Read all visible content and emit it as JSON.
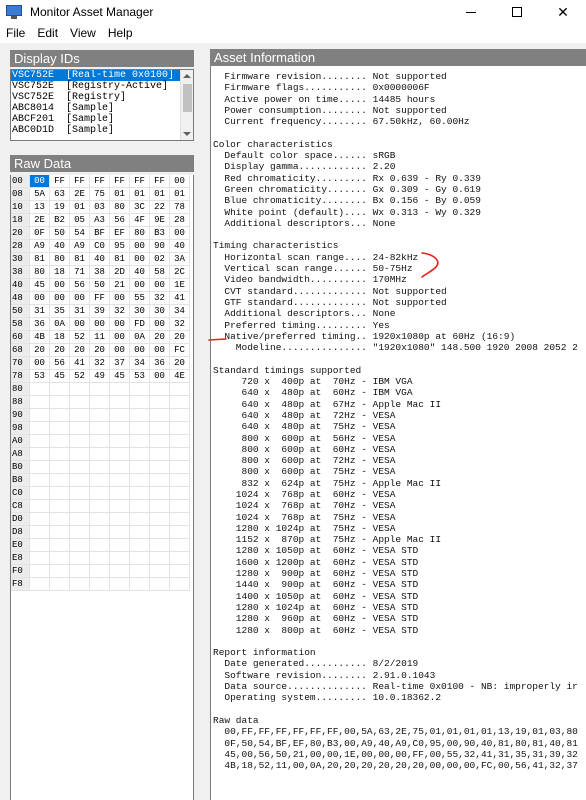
{
  "window": {
    "title": "Monitor Asset Manager"
  },
  "menu": [
    "File",
    "Edit",
    "View",
    "Help"
  ],
  "display_ids": {
    "header": "Display IDs",
    "items": [
      "VSC752E  [Real-time 0x0100]",
      "VSC752E  [Registry-Active]",
      "VSC752E  [Registry]",
      "ABC8014  [Sample]",
      "ABCF201  [Sample]",
      "ABC0D1D  [Sample]"
    ]
  },
  "raw_data": {
    "header": "Raw Data",
    "rows": [
      [
        "00",
        "00",
        "FF",
        "FF",
        "FF",
        "FF",
        "FF",
        "FF",
        "00"
      ],
      [
        "08",
        "5A",
        "63",
        "2E",
        "75",
        "01",
        "01",
        "01",
        "01"
      ],
      [
        "10",
        "13",
        "19",
        "01",
        "03",
        "80",
        "3C",
        "22",
        "78"
      ],
      [
        "18",
        "2E",
        "B2",
        "05",
        "A3",
        "56",
        "4F",
        "9E",
        "28"
      ],
      [
        "20",
        "0F",
        "50",
        "54",
        "BF",
        "EF",
        "80",
        "B3",
        "00"
      ],
      [
        "28",
        "A9",
        "40",
        "A9",
        "C0",
        "95",
        "00",
        "90",
        "40"
      ],
      [
        "30",
        "81",
        "80",
        "81",
        "40",
        "81",
        "00",
        "02",
        "3A"
      ],
      [
        "38",
        "80",
        "18",
        "71",
        "38",
        "2D",
        "40",
        "58",
        "2C"
      ],
      [
        "40",
        "45",
        "00",
        "56",
        "50",
        "21",
        "00",
        "00",
        "1E"
      ],
      [
        "48",
        "00",
        "00",
        "00",
        "FF",
        "00",
        "55",
        "32",
        "41"
      ],
      [
        "50",
        "31",
        "35",
        "31",
        "39",
        "32",
        "30",
        "30",
        "34"
      ],
      [
        "58",
        "36",
        "0A",
        "00",
        "00",
        "00",
        "FD",
        "00",
        "32"
      ],
      [
        "60",
        "4B",
        "18",
        "52",
        "11",
        "00",
        "0A",
        "20",
        "20"
      ],
      [
        "68",
        "20",
        "20",
        "20",
        "20",
        "00",
        "00",
        "00",
        "FC"
      ],
      [
        "70",
        "00",
        "56",
        "41",
        "32",
        "37",
        "34",
        "36",
        "20"
      ],
      [
        "78",
        "53",
        "45",
        "52",
        "49",
        "45",
        "53",
        "00",
        "4E"
      ],
      [
        "80",
        "",
        "",
        "",
        "",
        "",
        "",
        "",
        ""
      ],
      [
        "88",
        "",
        "",
        "",
        "",
        "",
        "",
        "",
        ""
      ],
      [
        "90",
        "",
        "",
        "",
        "",
        "",
        "",
        "",
        ""
      ],
      [
        "98",
        "",
        "",
        "",
        "",
        "",
        "",
        "",
        ""
      ],
      [
        "A0",
        "",
        "",
        "",
        "",
        "",
        "",
        "",
        ""
      ],
      [
        "A8",
        "",
        "",
        "",
        "",
        "",
        "",
        "",
        ""
      ],
      [
        "B0",
        "",
        "",
        "",
        "",
        "",
        "",
        "",
        ""
      ],
      [
        "B8",
        "",
        "",
        "",
        "",
        "",
        "",
        "",
        ""
      ],
      [
        "C0",
        "",
        "",
        "",
        "",
        "",
        "",
        "",
        ""
      ],
      [
        "C8",
        "",
        "",
        "",
        "",
        "",
        "",
        "",
        ""
      ],
      [
        "D0",
        "",
        "",
        "",
        "",
        "",
        "",
        "",
        ""
      ],
      [
        "D8",
        "",
        "",
        "",
        "",
        "",
        "",
        "",
        ""
      ],
      [
        "E0",
        "",
        "",
        "",
        "",
        "",
        "",
        "",
        ""
      ],
      [
        "E8",
        "",
        "",
        "",
        "",
        "",
        "",
        "",
        ""
      ],
      [
        "F0",
        "",
        "",
        "",
        "",
        "",
        "",
        "",
        ""
      ],
      [
        "F8",
        "",
        "",
        "",
        "",
        "",
        "",
        "",
        ""
      ]
    ]
  },
  "asset_info": {
    "header": "Asset Information",
    "lines": [
      "  Firmware revision........ Not supported",
      "  Firmware flags........... 0x0000006F",
      "  Active power on time..... 14485 hours",
      "  Power consumption........ Not supported",
      "  Current frequency........ 67.50kHz, 60.00Hz",
      "",
      "Color characteristics",
      "  Default color space...... sRGB",
      "  Display gamma............ 2.20",
      "  Red chromaticity......... Rx 0.639 - Ry 0.339",
      "  Green chromaticity....... Gx 0.309 - Gy 0.619",
      "  Blue chromaticity........ Bx 0.156 - By 0.059",
      "  White point (default).... Wx 0.313 - Wy 0.329",
      "  Additional descriptors... None",
      "",
      "Timing characteristics",
      "  Horizontal scan range.... 24-82kHz",
      "  Vertical scan range...... 50-75Hz",
      "  Video bandwidth.......... 170MHz",
      "  CVT standard............. Not supported",
      "  GTF standard............. Not supported",
      "  Additional descriptors... None",
      "  Preferred timing......... Yes",
      "  Native/preferred timing.. 1920x1080p at 60Hz (16:9)",
      "    Modeline............... \"1920x1080\" 148.500 1920 2008 2052 2",
      "",
      "Standard timings supported",
      "     720 x  400p at  70Hz - IBM VGA",
      "     640 x  480p at  60Hz - IBM VGA",
      "     640 x  480p at  67Hz - Apple Mac II",
      "     640 x  480p at  72Hz - VESA",
      "     640 x  480p at  75Hz - VESA",
      "     800 x  600p at  56Hz - VESA",
      "     800 x  600p at  60Hz - VESA",
      "     800 x  600p at  72Hz - VESA",
      "     800 x  600p at  75Hz - VESA",
      "     832 x  624p at  75Hz - Apple Mac II",
      "    1024 x  768p at  60Hz - VESA",
      "    1024 x  768p at  70Hz - VESA",
      "    1024 x  768p at  75Hz - VESA",
      "    1280 x 1024p at  75Hz - VESA",
      "    1152 x  870p at  75Hz - Apple Mac II",
      "    1280 x 1050p at  60Hz - VESA STD",
      "    1600 x 1200p at  60Hz - VESA STD",
      "    1280 x  900p at  60Hz - VESA STD",
      "    1440 x  900p at  60Hz - VESA STD",
      "    1400 x 1050p at  60Hz - VESA STD",
      "    1280 x 1024p at  60Hz - VESA STD",
      "    1280 x  960p at  60Hz - VESA STD",
      "    1280 x  800p at  60Hz - VESA STD",
      "",
      "Report information",
      "  Date generated........... 8/2/2019",
      "  Software revision........ 2.91.0.1043",
      "  Data source.............. Real-time 0x0100 - NB: improperly ir",
      "  Operating system......... 10.0.18362.2",
      "",
      "Raw data",
      "  00,FF,FF,FF,FF,FF,FF,00,5A,63,2E,75,01,01,01,01,13,19,01,03,80",
      "  0F,50,54,BF,EF,80,B3,00,A9,40,A9,C0,95,00,90,40,81,80,81,40,81",
      "  45,00,56,50,21,00,00,1E,00,00,00,FF,00,55,32,41,31,35,31,39,32",
      "  4B,18,52,11,00,0A,20,20,20,20,20,20,00,00,00,FC,00,56,41,32,37"
    ]
  },
  "colors": {
    "selection": "#0078d7",
    "header_bg": "#808080",
    "annotation": "#e8231c"
  }
}
